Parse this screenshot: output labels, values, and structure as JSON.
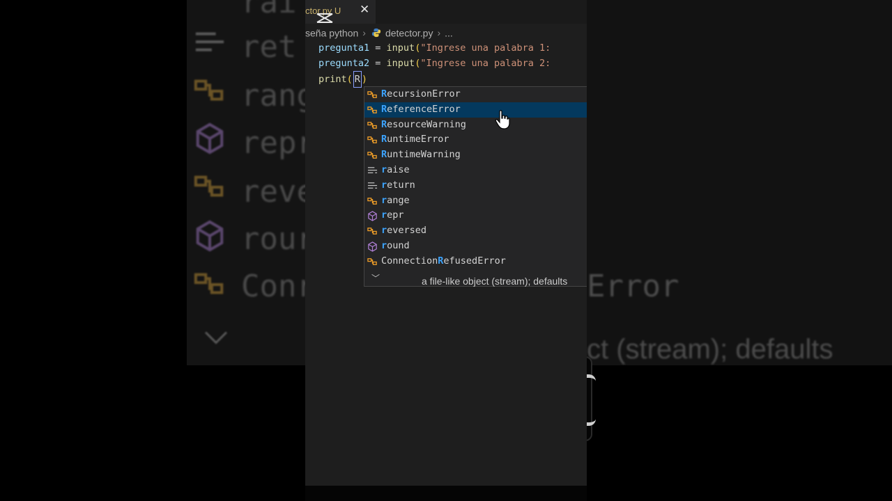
{
  "tab": {
    "label": "ctor.py U",
    "close_glyph": "✕"
  },
  "breadcrumb": {
    "folder": "seña python",
    "file": "detector.py",
    "ellipsis": "..."
  },
  "code": {
    "line1": {
      "var": "pregunta1",
      "op": " = ",
      "fn": "input",
      "paren": "(",
      "str": "\"Ingrese una palabra 1:"
    },
    "line2": {
      "var": "pregunta2",
      "op": " = ",
      "fn": "input",
      "paren": "(",
      "str": "\"Ingrese una palabra 2:"
    },
    "line3": {
      "fn": "print",
      "paren_open": "(",
      "typed": "R",
      "paren_close": ")"
    }
  },
  "suggestions": [
    {
      "match": "R",
      "rest": "ecursionError",
      "icon": "class-icon",
      "selected": false
    },
    {
      "match": "R",
      "rest": "eferenceError",
      "icon": "class-icon",
      "selected": true
    },
    {
      "match": "R",
      "rest": "esourceWarning",
      "icon": "class-icon",
      "selected": false
    },
    {
      "match": "R",
      "rest": "untimeError",
      "icon": "class-icon",
      "selected": false
    },
    {
      "match": "R",
      "rest": "untimeWarning",
      "icon": "class-icon",
      "selected": false
    },
    {
      "match": "r",
      "rest": "aise",
      "icon": "keyword-icon",
      "selected": false
    },
    {
      "match": "r",
      "rest": "eturn",
      "icon": "keyword-icon",
      "selected": false
    },
    {
      "match": "r",
      "rest": "ange",
      "icon": "class-icon",
      "selected": false
    },
    {
      "match": "r",
      "rest": "epr",
      "icon": "function-icon",
      "selected": false
    },
    {
      "match": "r",
      "rest": "eversed",
      "icon": "class-icon",
      "selected": false
    },
    {
      "match": "r",
      "rest": "ound",
      "icon": "function-icon",
      "selected": false
    },
    {
      "pre": "Connection",
      "match": "R",
      "rest": "efusedError",
      "icon": "class-icon",
      "selected": false
    }
  ],
  "doc_text": "a file-like object (stream); defaults",
  "background": {
    "left": [
      "rai",
      "ret",
      "rang",
      "repr",
      "reve",
      "rour",
      "Conr"
    ],
    "right": [
      "Error",
      "ct (stream); defaults"
    ]
  },
  "colors": {
    "editor_bg": "#1e1e1e",
    "suggest_bg": "#252526",
    "match": "#3ca4ff",
    "class_icon": "#ee9d28",
    "function_icon": "#b180d7"
  }
}
